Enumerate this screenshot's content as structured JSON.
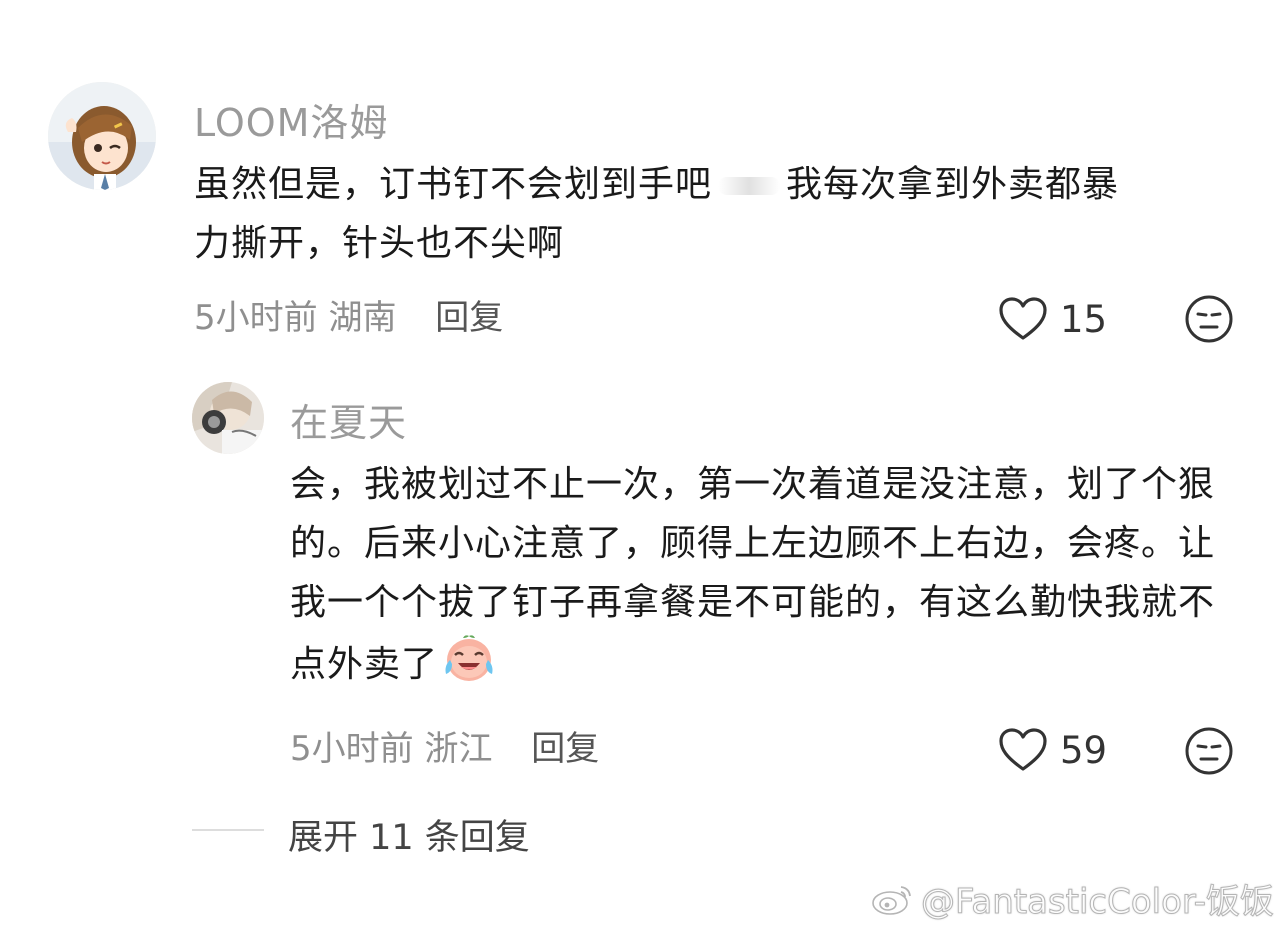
{
  "comments": [
    {
      "username": "LOOM洛姆",
      "text_line1": "虽然但是，订书钉不会划到手吧",
      "text_line1b": "我每次拿到外卖都暴",
      "text_line2": "力撕开，针头也不尖啊",
      "time": "5小时前",
      "location": "湖南",
      "reply_label": "回复",
      "likes": "15",
      "avatar_icon": "anime-girl-avatar"
    },
    {
      "username": "在夏天",
      "text": "会，我被划过不止一次，第一次着道是没注意，划了个狠的。后来小心注意了，顾得上左边顾不上右边，会疼。让我一个个拔了钉子再拿餐是不可能的，有这么勤快我就不点外卖了",
      "emoji": "crying-laughing-peach-emoji",
      "time": "5小时前",
      "location": "浙江",
      "reply_label": "回复",
      "likes": "59",
      "avatar_icon": "anime-character-avatar"
    }
  ],
  "expand_replies": "展开 11 条回复",
  "watermark": "@FantasticColor-饭饭",
  "icons": {
    "like": "heart-outline-icon",
    "dislike": "neutral-face-icon",
    "watermark": "weibo-logo-icon"
  },
  "colors": {
    "username": "#9a9a9a",
    "text": "#1a1a1a",
    "meta": "#8f8f8f",
    "icon": "#333333"
  }
}
